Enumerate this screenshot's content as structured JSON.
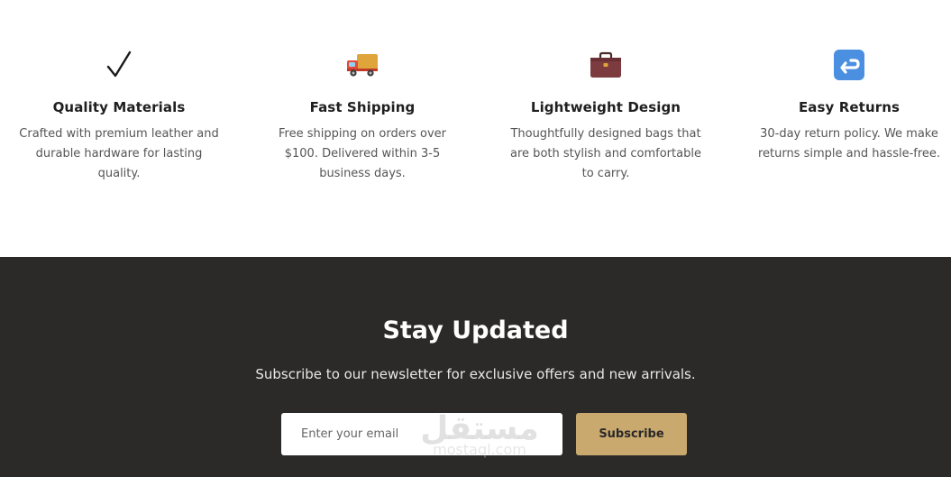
{
  "features": [
    {
      "icon": "check-icon",
      "title": "Quality Materials",
      "desc": "Crafted with premium leather and durable hardware for lasting quality."
    },
    {
      "icon": "delivery-truck-icon",
      "title": "Fast Shipping",
      "desc": "Free shipping on orders over $100. Delivered within 3-5 business days."
    },
    {
      "icon": "briefcase-icon",
      "title": "Lightweight Design",
      "desc": "Thoughtfully designed bags that are both stylish and comfortable to carry."
    },
    {
      "icon": "return-arrow-icon",
      "title": "Easy Returns",
      "desc": "30-day return policy. We make returns simple and hassle-free."
    }
  ],
  "newsletter": {
    "title": "Stay Updated",
    "subtitle": "Subscribe to our newsletter for exclusive offers and new arrivals.",
    "email_placeholder": "Enter your email",
    "subscribe_label": "Subscribe"
  },
  "watermark": {
    "arabic": "مستقل",
    "latin": "mostaql.com"
  },
  "colors": {
    "dark_bg": "#2b2a29",
    "accent": "#c9a96e"
  }
}
